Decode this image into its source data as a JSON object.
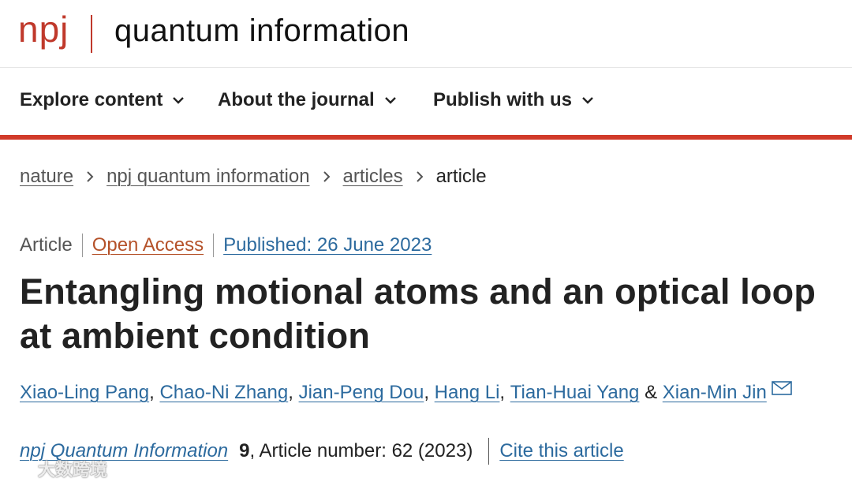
{
  "header": {
    "logo_npj": "npj",
    "logo_title": "quantum information"
  },
  "nav": {
    "items": [
      {
        "label": "Explore content"
      },
      {
        "label": "About the journal"
      },
      {
        "label": "Publish with us"
      }
    ]
  },
  "breadcrumb": {
    "items": [
      {
        "label": "nature"
      },
      {
        "label": "npj quantum information"
      },
      {
        "label": "articles"
      }
    ],
    "current": "article"
  },
  "meta": {
    "type": "Article",
    "access": "Open Access",
    "published": "Published: 26 June 2023"
  },
  "title": "Entangling motional atoms and an optical loop at ambient condition",
  "authors": {
    "names": [
      "Xiao-Ling Pang",
      "Chao-Ni Zhang",
      "Jian-Peng Dou",
      "Hang Li",
      "Tian-Huai Yang",
      "Xian-Min Jin"
    ],
    "comma": ",",
    "ampersand": "&"
  },
  "citation": {
    "journal": "npj Quantum Information",
    "volume": "9",
    "details": ", Article number: 62 (2023)",
    "cite_label": "Cite this article"
  },
  "watermark": {
    "text": "大数跨境"
  },
  "colors": {
    "brand_red": "#c0392b",
    "nav_rule": "#d13b2a",
    "link_blue": "#2c6a9e",
    "open_access": "#b5522a"
  }
}
